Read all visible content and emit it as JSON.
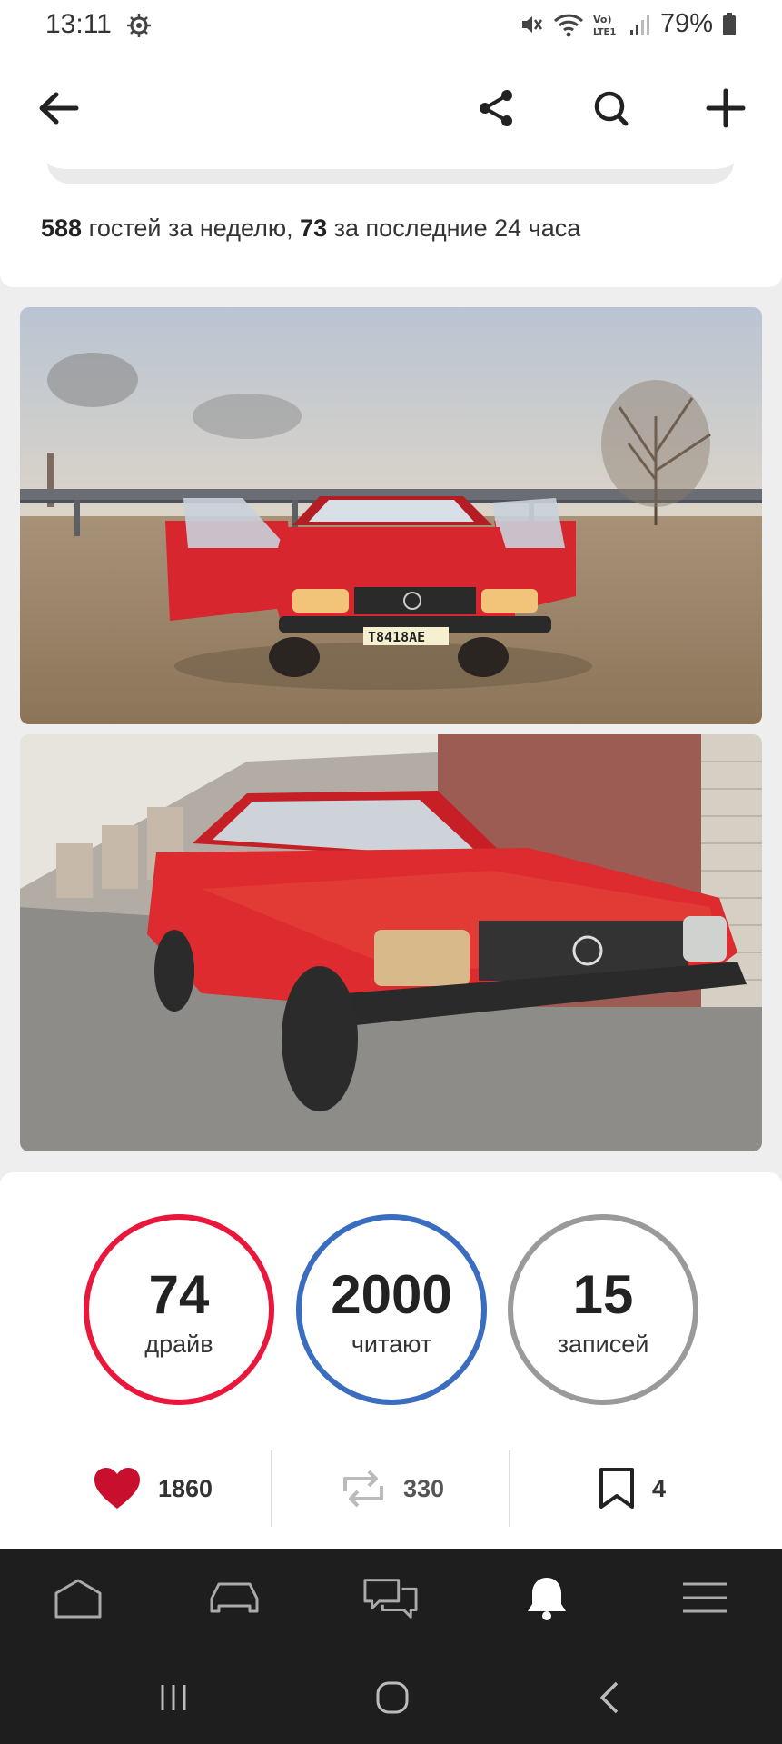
{
  "status_bar": {
    "time": "13:11",
    "battery": "79%",
    "icons": [
      "wake-gear-icon",
      "mute-icon",
      "wifi-icon",
      "volte-icon",
      "signal-icon",
      "battery-icon"
    ]
  },
  "header": {
    "icons": [
      "back-arrow-icon",
      "share-icon",
      "search-icon",
      "plus-icon"
    ]
  },
  "guests": {
    "week_count": "588",
    "week_text": " гостей за неделю, ",
    "day_count": "73",
    "day_text": " за последние 24 часа"
  },
  "photos": [
    {
      "subject": "red-car-doors-open"
    },
    {
      "subject": "red-car-garages"
    }
  ],
  "stats": [
    {
      "value": "74",
      "label": "драйв",
      "color": "#e8173b"
    },
    {
      "value": "2000",
      "label": "читают",
      "color": "#3a6cc0"
    },
    {
      "value": "15",
      "label": "записей",
      "color": "#9a9a9a"
    }
  ],
  "actions": {
    "likes": "1860",
    "reposts": "330",
    "bookmarks": "4"
  },
  "bottom_nav": {
    "items": [
      "home-icon",
      "car-icon",
      "chat-icon",
      "bell-icon",
      "menu-icon"
    ],
    "active": "bell-icon"
  },
  "colors": {
    "accent_red": "#e8173b",
    "accent_blue": "#3a6cc0",
    "nav_bg": "#1e1e1e"
  }
}
